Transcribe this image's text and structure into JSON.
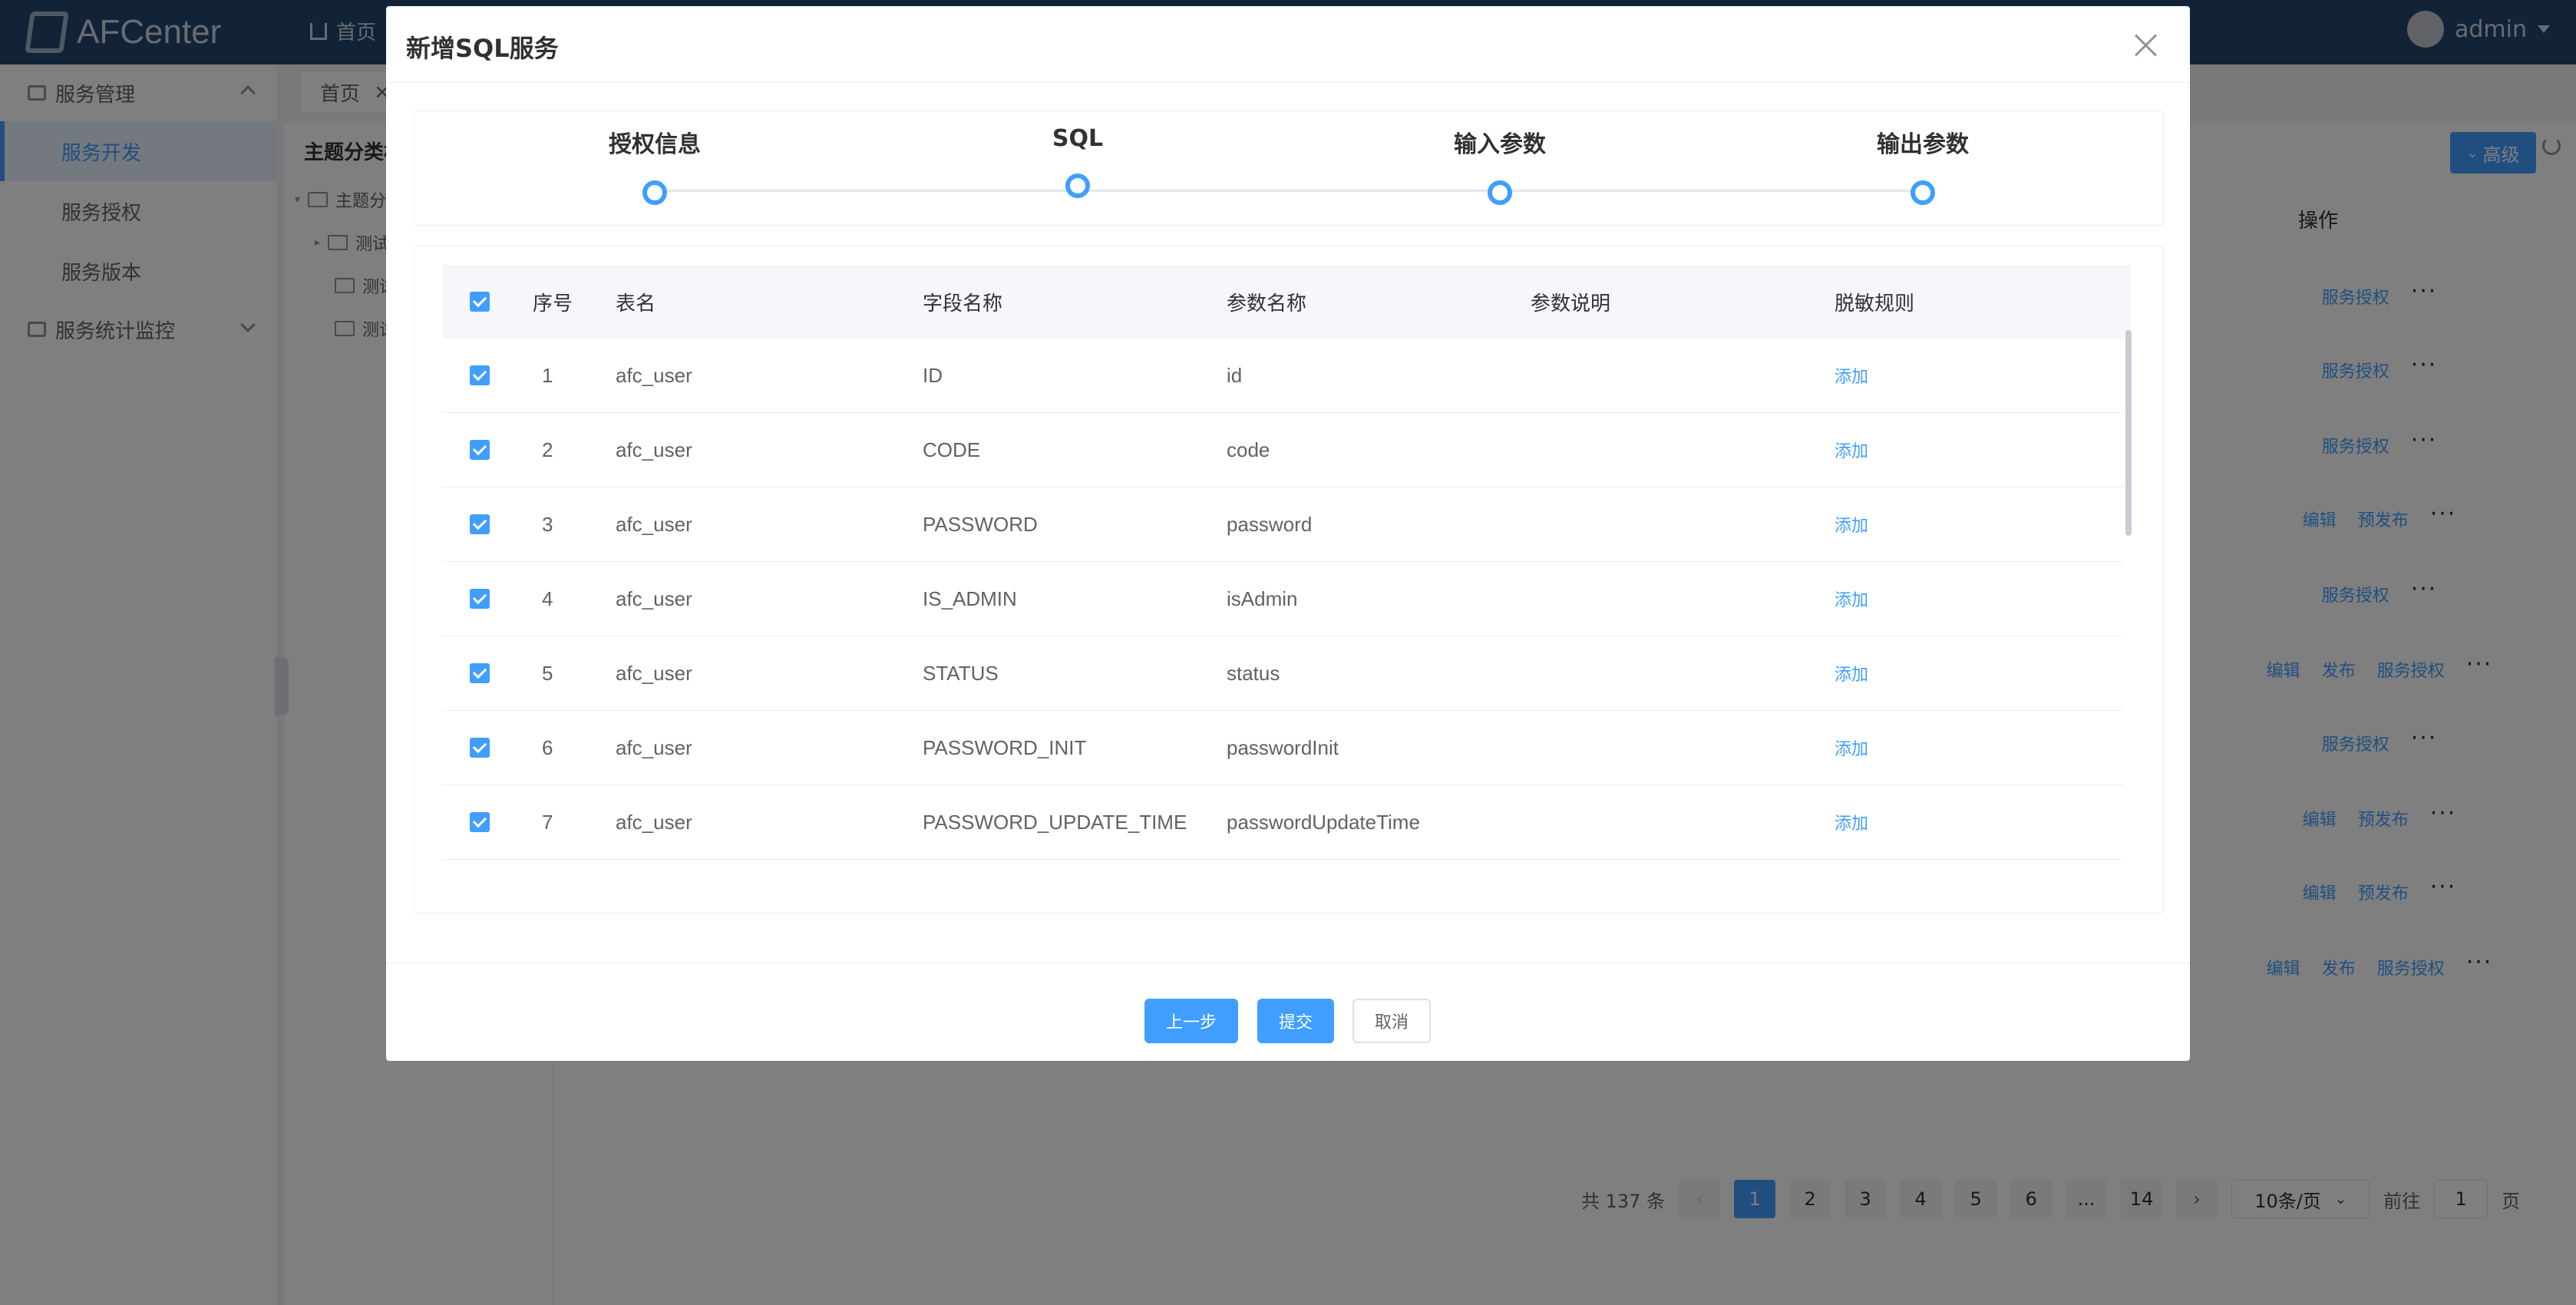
{
  "app": {
    "logo_text": "AFCenter",
    "nav_home": "首页",
    "user_name": "admin"
  },
  "sidebar": {
    "groups": [
      {
        "label": "服务管理",
        "items": [
          "服务开发",
          "服务授权",
          "服务版本"
        ]
      },
      {
        "label": "服务统计监控",
        "items": []
      }
    ],
    "active_item": "服务开发"
  },
  "tabs": {
    "home_label": "首页",
    "close_glyph": "×"
  },
  "tree": {
    "title": "主题分类树",
    "nodes": [
      "主题分类",
      "测试",
      "测试",
      "测试"
    ]
  },
  "toolbar": {
    "advanced_label": "高级",
    "advanced_icon": "double-chevron-down-icon"
  },
  "main_table": {
    "op_header": "操作",
    "rows": [
      [
        "服务授权"
      ],
      [
        "服务授权"
      ],
      [
        "服务授权"
      ],
      [
        "编辑",
        "预发布"
      ],
      [
        "服务授权"
      ],
      [
        "编辑",
        "发布",
        "服务授权"
      ],
      [
        "服务授权"
      ],
      [
        "编辑",
        "预发布"
      ],
      [
        "编辑",
        "预发布"
      ],
      [
        "编辑",
        "发布",
        "服务授权"
      ]
    ],
    "more_glyph": "···"
  },
  "pagination": {
    "total_text": "共 137 条",
    "pages": [
      "1",
      "2",
      "3",
      "4",
      "5",
      "6",
      "...",
      "14"
    ],
    "current_page": "1",
    "page_size": "10条/页",
    "goto_prefix": "前往",
    "goto_value": "1",
    "goto_suffix": "页"
  },
  "dialog": {
    "title": "新增SQL服务",
    "steps": [
      "授权信息",
      "SQL",
      "输入参数",
      "输出参数"
    ],
    "columns": {
      "index": "序号",
      "table_name": "表名",
      "field_name": "字段名称",
      "param_name": "参数名称",
      "param_desc": "参数说明",
      "mask_rule": "脱敏规则"
    },
    "rows": [
      {
        "index": "1",
        "table_name": "afc_user",
        "field_name": "ID",
        "param_name": "id",
        "param_desc": "",
        "action": "添加"
      },
      {
        "index": "2",
        "table_name": "afc_user",
        "field_name": "CODE",
        "param_name": "code",
        "param_desc": "",
        "action": "添加"
      },
      {
        "index": "3",
        "table_name": "afc_user",
        "field_name": "PASSWORD",
        "param_name": "password",
        "param_desc": "",
        "action": "添加"
      },
      {
        "index": "4",
        "table_name": "afc_user",
        "field_name": "IS_ADMIN",
        "param_name": "isAdmin",
        "param_desc": "",
        "action": "添加"
      },
      {
        "index": "5",
        "table_name": "afc_user",
        "field_name": "STATUS",
        "param_name": "status",
        "param_desc": "",
        "action": "添加"
      },
      {
        "index": "6",
        "table_name": "afc_user",
        "field_name": "PASSWORD_INIT",
        "param_name": "passwordInit",
        "param_desc": "",
        "action": "添加"
      },
      {
        "index": "7",
        "table_name": "afc_user",
        "field_name": "PASSWORD_UPDATE_TIME",
        "param_name": "passwordUpdateTime",
        "param_desc": "",
        "action": "添加"
      }
    ],
    "buttons": {
      "prev": "上一步",
      "submit": "提交",
      "cancel": "取消"
    }
  },
  "colors": {
    "primary": "#409eff",
    "topbar": "#24446f",
    "overlay": "rgba(0,0,0,0.5)"
  }
}
